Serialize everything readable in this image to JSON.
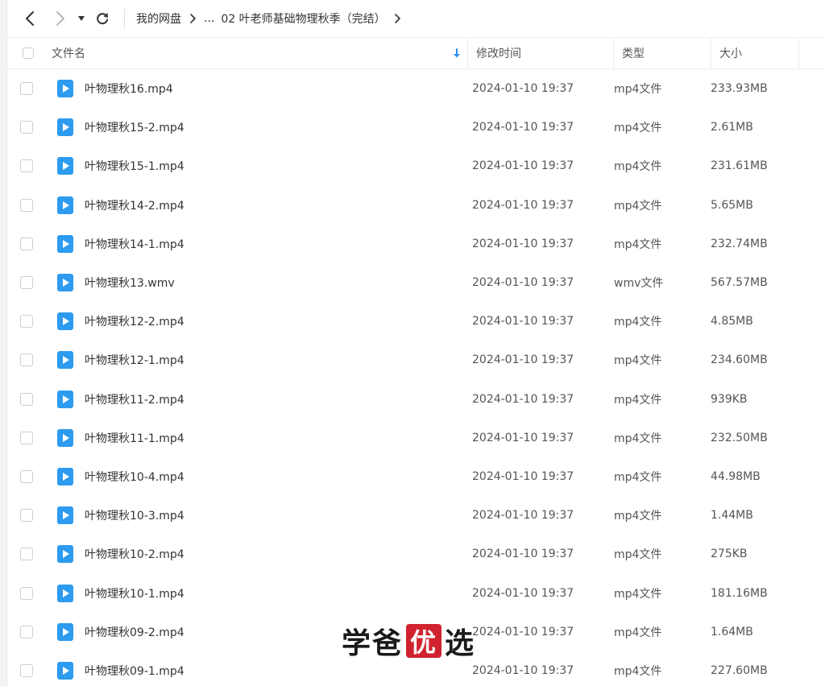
{
  "toolbar": {
    "back_icon": "chevron-left-icon",
    "forward_icon": "chevron-right-icon",
    "history_icon": "caret-down-icon",
    "refresh_icon": "refresh-icon"
  },
  "breadcrumb": {
    "root": "我的网盘",
    "ellipsis": "...",
    "current": "02 叶老师基础物理秋季（完结）"
  },
  "header": {
    "name": "文件名",
    "modified": "修改时间",
    "type": "类型",
    "size": "大小"
  },
  "colors": {
    "file_icon": "#2d9bf0",
    "sort_icon": "#2a8ef2",
    "seal": "#d0232f"
  },
  "files": [
    {
      "name": "叶物理秋16.mp4",
      "modified": "2024-01-10 19:37",
      "type": "mp4文件",
      "size": "233.93MB"
    },
    {
      "name": "叶物理秋15-2.mp4",
      "modified": "2024-01-10 19:37",
      "type": "mp4文件",
      "size": "2.61MB"
    },
    {
      "name": "叶物理秋15-1.mp4",
      "modified": "2024-01-10 19:37",
      "type": "mp4文件",
      "size": "231.61MB"
    },
    {
      "name": "叶物理秋14-2.mp4",
      "modified": "2024-01-10 19:37",
      "type": "mp4文件",
      "size": "5.65MB"
    },
    {
      "name": "叶物理秋14-1.mp4",
      "modified": "2024-01-10 19:37",
      "type": "mp4文件",
      "size": "232.74MB"
    },
    {
      "name": "叶物理秋13.wmv",
      "modified": "2024-01-10 19:37",
      "type": "wmv文件",
      "size": "567.57MB"
    },
    {
      "name": "叶物理秋12-2.mp4",
      "modified": "2024-01-10 19:37",
      "type": "mp4文件",
      "size": "4.85MB"
    },
    {
      "name": "叶物理秋12-1.mp4",
      "modified": "2024-01-10 19:37",
      "type": "mp4文件",
      "size": "234.60MB"
    },
    {
      "name": "叶物理秋11-2.mp4",
      "modified": "2024-01-10 19:37",
      "type": "mp4文件",
      "size": "939KB"
    },
    {
      "name": "叶物理秋11-1.mp4",
      "modified": "2024-01-10 19:37",
      "type": "mp4文件",
      "size": "232.50MB"
    },
    {
      "name": "叶物理秋10-4.mp4",
      "modified": "2024-01-10 19:37",
      "type": "mp4文件",
      "size": "44.98MB"
    },
    {
      "name": "叶物理秋10-3.mp4",
      "modified": "2024-01-10 19:37",
      "type": "mp4文件",
      "size": "1.44MB"
    },
    {
      "name": "叶物理秋10-2.mp4",
      "modified": "2024-01-10 19:37",
      "type": "mp4文件",
      "size": "275KB"
    },
    {
      "name": "叶物理秋10-1.mp4",
      "modified": "2024-01-10 19:37",
      "type": "mp4文件",
      "size": "181.16MB"
    },
    {
      "name": "叶物理秋09-2.mp4",
      "modified": "2024-01-10 19:37",
      "type": "mp4文件",
      "size": "1.64MB"
    },
    {
      "name": "叶物理秋09-1.mp4",
      "modified": "2024-01-10 19:37",
      "type": "mp4文件",
      "size": "227.60MB"
    }
  ],
  "watermark": {
    "part1": "学爸",
    "seal": "优",
    "part2": "选"
  }
}
